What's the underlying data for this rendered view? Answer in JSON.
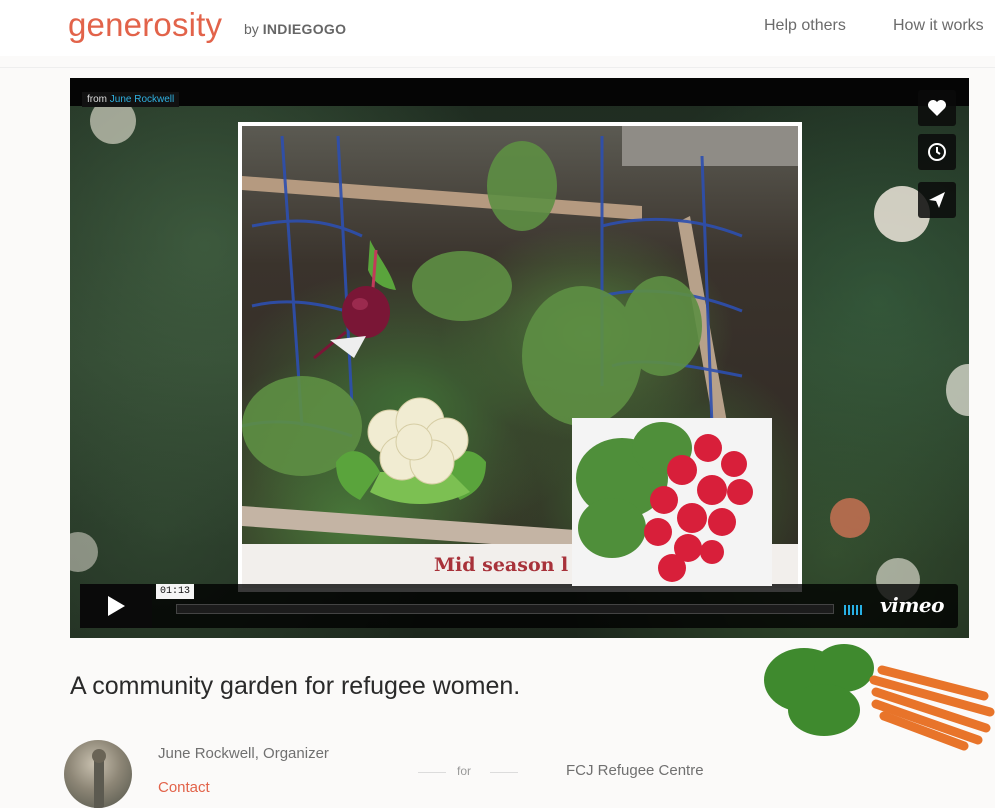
{
  "header": {
    "logo": "generosity",
    "logo_by_prefix": "by",
    "logo_by_brand": "INDIEGOGO",
    "nav": [
      {
        "label": "Help others"
      },
      {
        "label": "How it works"
      }
    ]
  },
  "video": {
    "from_prefix": "from",
    "author": "June Rockwell",
    "caption": "Mid season l",
    "time": "01:13",
    "brand": "vimeo",
    "icons": [
      "heart-icon",
      "clock-icon",
      "send-icon"
    ],
    "progress": 0.0
  },
  "campaign": {
    "title": "A community garden for refugee women.",
    "organizer": "June Rockwell, Organizer",
    "contact": "Contact",
    "for_label": "for",
    "beneficiary": "FCJ Refugee Centre"
  },
  "colors": {
    "brand": "#e2634a",
    "vimeo_blue": "#28b0e4",
    "caption_red": "#a8323a"
  }
}
